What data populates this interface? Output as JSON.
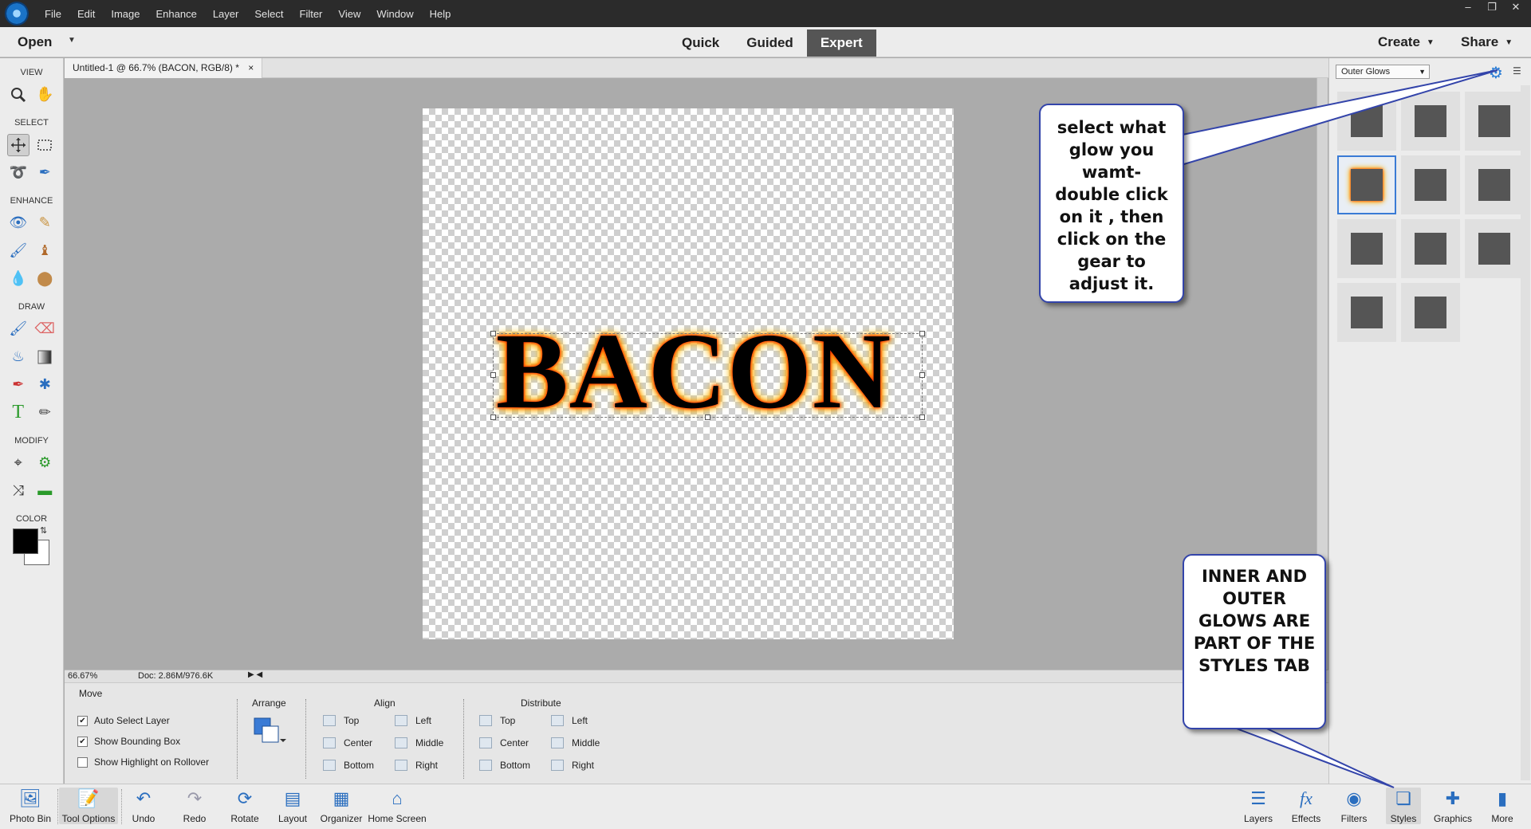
{
  "menu": [
    "File",
    "Edit",
    "Image",
    "Enhance",
    "Layer",
    "Select",
    "Filter",
    "View",
    "Window",
    "Help"
  ],
  "window_controls": [
    "–",
    "❐",
    "✕"
  ],
  "topbar": {
    "open_label": "Open",
    "modes": [
      "Quick",
      "Guided",
      "Expert"
    ],
    "active_mode": "Expert",
    "create_label": "Create",
    "share_label": "Share"
  },
  "toolbox": {
    "sections": {
      "view": "VIEW",
      "select": "SELECT",
      "enhance": "ENHANCE",
      "draw": "DRAW",
      "modify": "MODIFY",
      "color": "COLOR"
    },
    "foreground_color": "#000000",
    "background_color": "#ffffff"
  },
  "document": {
    "tab_title": "Untitled-1 @ 66.7% (BACON, RGB/8) *",
    "close_glyph": "×",
    "text_layer": "BACON"
  },
  "statusbar": {
    "zoom": "66.67%",
    "doc_size": "Doc: 2.86M/976.6K"
  },
  "tool_options": {
    "title": "Move",
    "auto_select": "Auto Select Layer",
    "show_bbox": "Show Bounding Box",
    "show_highlight": "Show Highlight on Rollover",
    "arrange": "Arrange",
    "align": "Align",
    "distribute": "Distribute",
    "align_items": [
      "Top",
      "Center",
      "Bottom",
      "Left",
      "Middle",
      "Right"
    ],
    "distribute_items": [
      "Top",
      "Center",
      "Bottom",
      "Left",
      "Middle",
      "Right"
    ]
  },
  "right_panel": {
    "style_category": "Outer Glows",
    "selected_index": 3,
    "thumb_count": 11
  },
  "taskbar": {
    "left": [
      "Photo Bin",
      "Tool Options",
      "Undo",
      "Redo",
      "Rotate",
      "Layout",
      "Organizer",
      "Home Screen"
    ],
    "right": [
      "Layers",
      "Effects",
      "Filters",
      "Styles",
      "Graphics",
      "More"
    ],
    "active_right": "Styles"
  },
  "callouts": {
    "gear_tip": "select what glow you wamt- double click on it , then click on the gear to adjust it.",
    "styles_tip": "INNER AND OUTER GLOWS ARE PART OF THE STYLES TAB"
  }
}
